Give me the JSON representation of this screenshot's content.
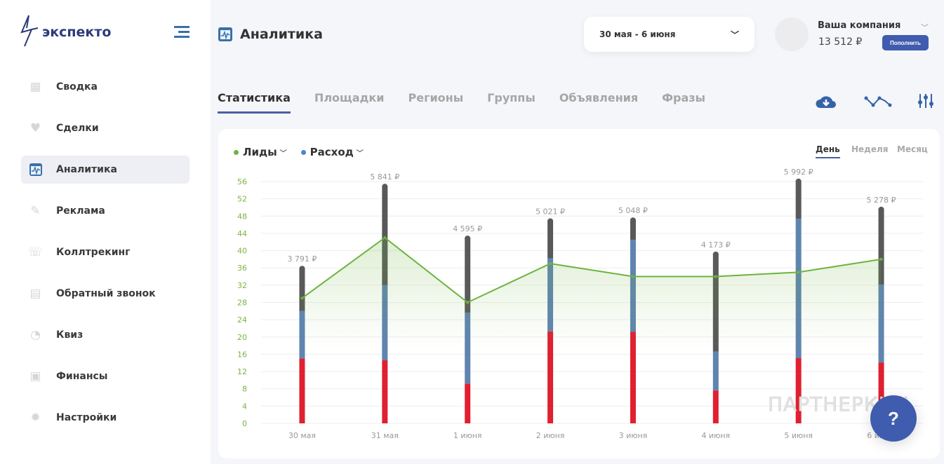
{
  "brand": {
    "name": "экспекто"
  },
  "sidebar": {
    "items": [
      {
        "label": "Сводка",
        "icon": "grid-icon"
      },
      {
        "label": "Сделки",
        "icon": "handshake-icon"
      },
      {
        "label": "Аналитика",
        "icon": "analytics-icon",
        "active": true
      },
      {
        "label": "Реклама",
        "icon": "megaphone-icon"
      },
      {
        "label": "Коллтрекинг",
        "icon": "phone-icon"
      },
      {
        "label": "Обратный звонок",
        "icon": "chat-icon"
      },
      {
        "label": "Квиз",
        "icon": "quiz-icon"
      },
      {
        "label": "Финансы",
        "icon": "wallet-icon"
      },
      {
        "label": "Настройки",
        "icon": "gear-icon"
      }
    ]
  },
  "header": {
    "title": "Аналитика",
    "date_range": "30 мая - 6 июня",
    "company": "Ваша компания",
    "balance": "13 512 ₽",
    "topup_label": "Пополнить"
  },
  "tabs": [
    "Статистика",
    "Площадки",
    "Регионы",
    "Группы",
    "Объявления",
    "Фразы"
  ],
  "legend": {
    "leads": "Лиды",
    "expense": "Расход"
  },
  "periods": [
    "День",
    "Неделя",
    "Месяц"
  ],
  "help_label": "?",
  "watermark": "ПАРТНЕРКИН",
  "colors": {
    "accent": "#3f5cae",
    "leads": "#6db33f",
    "expense": "#4a86c8",
    "red": "#e02030",
    "blue": "#5f84b0",
    "gray": "#595959"
  },
  "chart_data": {
    "type": "bar",
    "categories": [
      "30 мая",
      "31 мая",
      "1 июня",
      "2 июня",
      "3 июня",
      "4 июня",
      "5 июня",
      "6 июня"
    ],
    "ylim": [
      0,
      56
    ],
    "yticks": [
      0,
      4,
      8,
      12,
      16,
      20,
      24,
      28,
      32,
      36,
      40,
      44,
      48,
      52,
      56
    ],
    "series": [
      {
        "name": "red",
        "stacked": true,
        "values": [
          15,
          14.6,
          9.2,
          21.3,
          21.2,
          7.6,
          15.1,
          14.1
        ]
      },
      {
        "name": "blue",
        "stacked": true,
        "values": [
          11,
          17.4,
          16.4,
          16.9,
          21.3,
          9,
          32.3,
          18
        ]
      },
      {
        "name": "gray",
        "stacked": true,
        "values": [
          10,
          23,
          17.4,
          8.8,
          4.7,
          22.7,
          8.8,
          17.6
        ]
      },
      {
        "name": "Лиды",
        "type": "line",
        "values": [
          29,
          43,
          28,
          37,
          34,
          34,
          35,
          38
        ]
      }
    ],
    "bar_labels": [
      "3 791 ₽",
      "5 841 ₽",
      "4 595 ₽",
      "5 021 ₽",
      "5 048 ₽",
      "4 173 ₽",
      "5 992 ₽",
      "5 278 ₽"
    ]
  }
}
